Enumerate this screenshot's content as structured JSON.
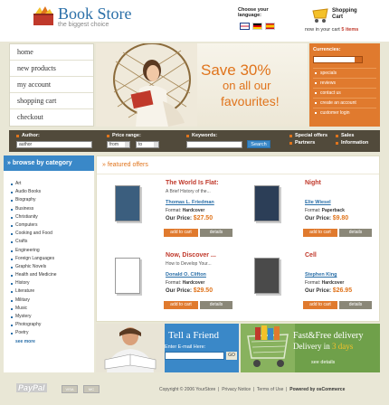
{
  "header": {
    "store_name": "Book Store",
    "tagline": "the biggest choice",
    "language_label": "Choose your language:",
    "cart_label": "Shopping Cart",
    "cart_prefix": "now in your cart",
    "cart_count": "5 items"
  },
  "nav": [
    "home",
    "new products",
    "my account",
    "shopping cart",
    "checkout"
  ],
  "banner": {
    "line1": "Save 30%",
    "line2": "on all our",
    "line3": "favourites!"
  },
  "currencies": {
    "title": "Currencies:",
    "links": [
      "specials",
      "reviews",
      "contact us",
      "create an account",
      "customer login"
    ]
  },
  "search": {
    "author_label": "Author:",
    "author_value": "author",
    "price_label": "Price range:",
    "price_from": "from",
    "price_to": "to",
    "keywords_label": "Keywords:",
    "search_button": "Search",
    "special_offers": "Special offers",
    "partners": "Partners",
    "sales": "Sales",
    "information": "Information"
  },
  "categories": {
    "title": "browse by category",
    "items": [
      "Art",
      "Audio Books",
      "Biography",
      "Business",
      "Christianity",
      "Computers",
      "Cooking and Food",
      "Crafts",
      "Engineering",
      "Foreign Languages",
      "Graphic Novels",
      "Health and Medicine",
      "History",
      "Literature",
      "Military",
      "Music",
      "Mystery",
      "Photography",
      "Poetry"
    ],
    "more": "see more"
  },
  "featured": {
    "title": "featured offers",
    "add_label": "add to cart",
    "details_label": "details",
    "format_label": "Format:",
    "price_label": "Our Price:",
    "books": [
      {
        "title": "The World Is Flat:",
        "subtitle": "A Brief History of the...",
        "author": "Thomas L. Friedman",
        "format": "Hardcover",
        "price": "$27.50",
        "cover_color": "#3b5e7e"
      },
      {
        "title": "Night",
        "subtitle": "",
        "author": "Elie Wiesel",
        "format": "Paperback",
        "price": "$9.80",
        "cover_color": "#2c3e57"
      },
      {
        "title": "Now, Discover ...",
        "subtitle": "How to Develop Your...",
        "author": "Donald O. Clifton",
        "format": "Hardcover",
        "price": "$29.50",
        "cover_color": "#ffffff"
      },
      {
        "title": "Cell",
        "subtitle": "",
        "author": "Stephen King",
        "format": "Hardcover",
        "price": "$26.95",
        "cover_color": "#4a4a4a"
      }
    ]
  },
  "promo_friend": {
    "title": "Tell a Friend",
    "label": "Enter E-mail Here:",
    "go": "GO"
  },
  "promo_delivery": {
    "title": "Fast&Free delivery",
    "sub_prefix": "Delivery in",
    "sub_days": "3 days",
    "details": "see details"
  },
  "footer": {
    "paypal": "PayPal",
    "visa": "VISA",
    "mastercard": "MC",
    "copyright": "Copyright © 2006 YourStore",
    "privacy": "Privacy Notice",
    "terms": "Terms of Use",
    "powered": "Powered by osCommerce"
  },
  "colors": {
    "accent_orange": "#e07a2e",
    "accent_blue": "#3a88c8",
    "search_bar": "#514a3b",
    "delivery_green": "#6fa04a"
  }
}
